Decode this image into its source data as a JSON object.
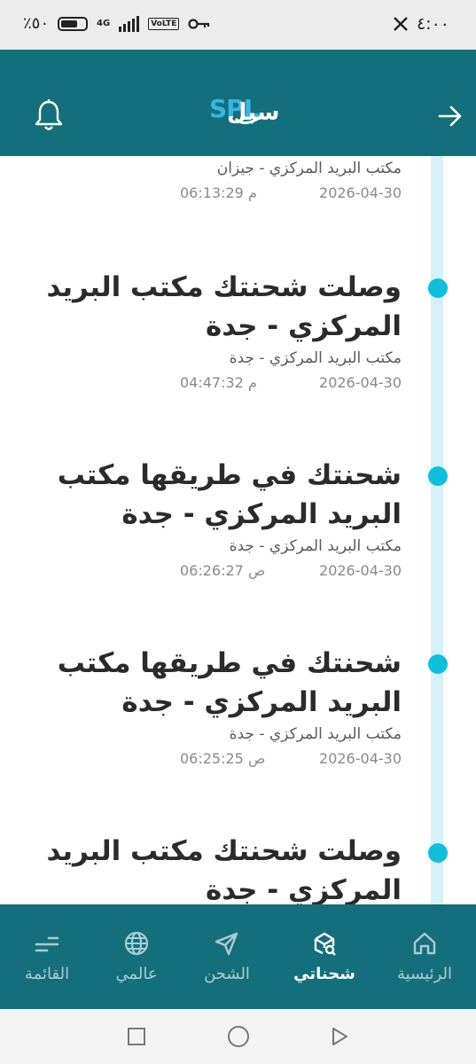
{
  "status_bar": {
    "time": "٤:٠٠",
    "network": "4G",
    "volte": "VoLTE",
    "battery_text": "٪٥٠"
  },
  "header": {
    "logo_text": "SPL",
    "logo_arabic": "سبل",
    "icons": [
      "back-arrow-icon",
      "spl-logo",
      "bell-icon"
    ]
  },
  "timeline": {
    "events": [
      {
        "title": "",
        "place": "مكتب البريد المركزي - جيزان",
        "date": "2026-04-30",
        "time": "06:13:29 م"
      },
      {
        "title": "وصلت شحنتك مكتب البريد المركزي - جدة",
        "place": "مكتب البريد المركزي - جدة",
        "date": "2026-04-30",
        "time": "04:47:32 م"
      },
      {
        "title": "شحنتك في طريقها مكتب البريد المركزي - جدة",
        "place": "مكتب البريد المركزي - جدة",
        "date": "2026-04-30",
        "time": "06:26:27 ص"
      },
      {
        "title": "شحنتك في طريقها مكتب البريد المركزي - جدة",
        "place": "مكتب البريد المركزي - جدة",
        "date": "2026-04-30",
        "time": "06:25:25 ص"
      },
      {
        "title": "وصلت شحنتك مكتب البريد المركزي - جدة",
        "place": "",
        "date": "",
        "time": ""
      }
    ]
  },
  "bottom_nav": {
    "items": [
      {
        "label": "الرئيسية",
        "icon": "home-icon"
      },
      {
        "label": "شحناتي",
        "icon": "package-search-icon"
      },
      {
        "label": "الشحن",
        "icon": "send-icon"
      },
      {
        "label": "عالمي",
        "icon": "globe-icon"
      },
      {
        "label": "القائمة",
        "icon": "menu-icon"
      }
    ],
    "active": "شحناتي"
  },
  "colors": {
    "primary": "#146f7c",
    "accent": "#0ec0dc",
    "track": "#d6f1f8"
  }
}
